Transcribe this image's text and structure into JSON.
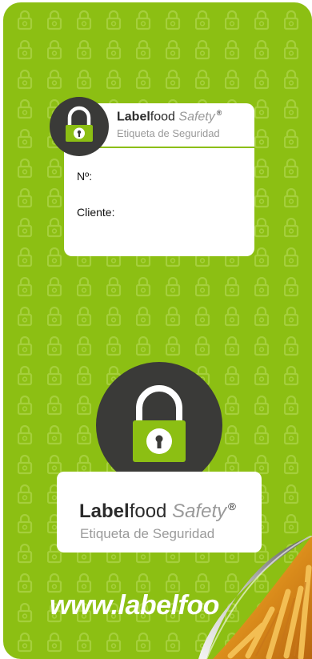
{
  "mini_label": {
    "brand_bold": "Label",
    "brand_regular": "food",
    "brand_italic": "Safety",
    "registered": "®",
    "subtitle": "Etiqueta de Seguridad",
    "field_number": "Nº:",
    "field_client": "Cliente:"
  },
  "main_label": {
    "brand_bold": "Label",
    "brand_regular": "food",
    "brand_italic": "Safety",
    "registered": "®",
    "subtitle": "Etiqueta de Seguridad"
  },
  "website": "www.labelfoo",
  "icons": [
    "lock-icon",
    "lock-pattern",
    "fries-photo",
    "page-curl"
  ],
  "colors": {
    "background_green": "#8cbf13",
    "pattern_green": "#a5cf3c",
    "dark_circle": "#3a3a38",
    "text_dark": "#2b2b2b",
    "text_gray": "#9a9a9a"
  }
}
